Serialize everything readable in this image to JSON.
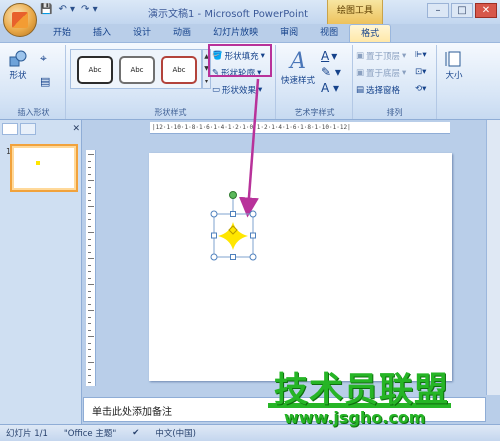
{
  "window": {
    "title": "演示文稿1 - Microsoft PowerPoint",
    "context_tab_group": "绘图工具"
  },
  "tabs": [
    "开始",
    "插入",
    "设计",
    "动画",
    "幻灯片放映",
    "审阅",
    "视图",
    "格式"
  ],
  "ribbon": {
    "insert_shapes": {
      "label": "插入形状",
      "shapes_button": "形状"
    },
    "shape_styles": {
      "label": "形状样式",
      "gallery": [
        "Abc",
        "Abc",
        "Abc"
      ],
      "fill": "形状填充",
      "outline": "形状轮廓",
      "effects": "形状效果"
    },
    "wordart": {
      "label": "艺术字样式",
      "quick_styles": "快速样式"
    },
    "arrange": {
      "label": "排列",
      "bring_front": "置于顶层",
      "send_back": "置于底层",
      "selection_pane": "选择窗格"
    },
    "size": {
      "label": "大小"
    }
  },
  "slides_panel": {
    "slide_number": "1"
  },
  "ruler_text": "|12·1·10·1·8·1·6·1·4·1·2·1·0·1·2·1·4·1·6·1·8·1·10·1·12|",
  "notes": {
    "placeholder": "单击此处添加备注"
  },
  "status": {
    "slide_info": "幻灯片 1/1",
    "theme": "\"Office 主题\"",
    "language": "中文(中国)"
  },
  "watermark": {
    "text": "技术员联盟",
    "url": "www.jsgho.com"
  },
  "colors": {
    "highlight": "#b8329a",
    "shape_fill": "#ffe600",
    "selection_handle": "#4f81bd",
    "rotate_handle": "#5cb85c",
    "watermark": "#26b526"
  }
}
